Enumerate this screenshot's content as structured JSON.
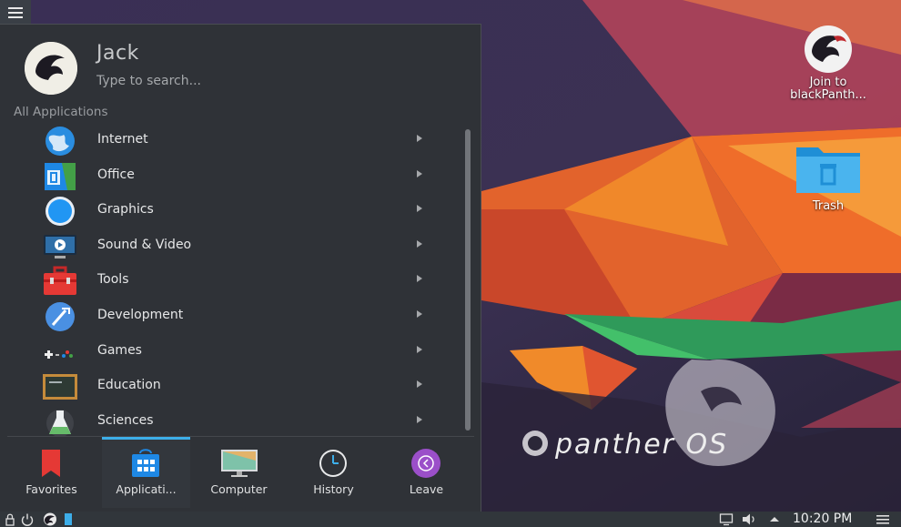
{
  "launcher": {
    "user_name": "Jack",
    "search_placeholder": "Type to search...",
    "section_label": "All Applications",
    "categories": [
      {
        "label": "Internet",
        "icon": "internet-globe-icon"
      },
      {
        "label": "Office",
        "icon": "office-icon"
      },
      {
        "label": "Graphics",
        "icon": "graphics-icon"
      },
      {
        "label": "Sound & Video",
        "icon": "sound-video-icon"
      },
      {
        "label": "Tools",
        "icon": "toolbox-icon"
      },
      {
        "label": "Development",
        "icon": "development-icon"
      },
      {
        "label": "Games",
        "icon": "gamepad-icon"
      },
      {
        "label": "Education",
        "icon": "chalkboard-icon"
      },
      {
        "label": "Sciences",
        "icon": "flask-icon"
      }
    ],
    "tabs": [
      {
        "label": "Favorites",
        "icon": "bookmark-icon"
      },
      {
        "label": "Applicati...",
        "icon": "applications-icon",
        "active": true
      },
      {
        "label": "Computer",
        "icon": "monitor-icon"
      },
      {
        "label": "History",
        "icon": "clock-icon"
      },
      {
        "label": "Leave",
        "icon": "leave-icon"
      }
    ]
  },
  "desktop": {
    "icons": [
      {
        "label_line1": "Join to",
        "label_line2": "blackPanth...",
        "icon": "panther-logo-icon"
      },
      {
        "label_line1": "Trash",
        "icon": "trash-folder-icon"
      }
    ],
    "watermark": "panther OS"
  },
  "taskbar": {
    "clock": "10:20 PM"
  },
  "colors": {
    "accent": "#3daee9",
    "panel_bg": "#2f3237",
    "taskbar_bg": "#31363b"
  }
}
